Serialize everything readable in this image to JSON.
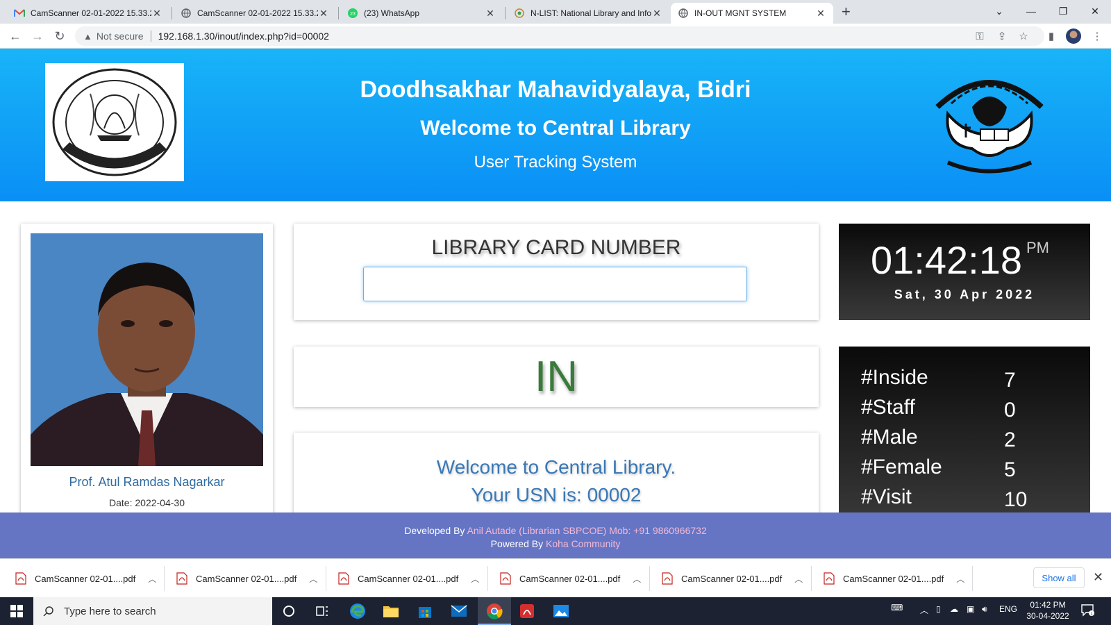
{
  "browser": {
    "tabs": [
      {
        "title": "CamScanner 02-01-2022 15.33.2",
        "icon": "gmail-icon",
        "active": false
      },
      {
        "title": "CamScanner 02-01-2022 15.33.2",
        "icon": "globe-icon",
        "active": false
      },
      {
        "title": "(23) WhatsApp",
        "icon": "whatsapp-icon",
        "active": false
      },
      {
        "title": "N-LIST: National Library and Info",
        "icon": "nlist-icon",
        "active": false
      },
      {
        "title": "IN-OUT MGNT SYSTEM",
        "icon": "globe-icon",
        "active": true
      }
    ],
    "security_label": "Not secure",
    "url": "192.168.1.30/inout/index.php?id=00002"
  },
  "header": {
    "title": "Doodhsakhar Mahavidyalaya, Bidri",
    "subtitle": "Welcome to Central Library",
    "tagline": "User Tracking System"
  },
  "user": {
    "name": "Prof. Atul Ramdas Nagarkar",
    "date": "Date: 2022-04-30"
  },
  "card_input": {
    "label": "LIBRARY CARD NUMBER",
    "value": ""
  },
  "status": "IN",
  "message": {
    "line1": "Welcome to Central Library.",
    "line2": "Your USN is: 00002"
  },
  "clock": {
    "time": "01:42:18",
    "ampm": "PM",
    "date": "Sat, 30 Apr 2022"
  },
  "stats": [
    {
      "label": "#Inside",
      "value": "7"
    },
    {
      "label": "#Staff",
      "value": "0"
    },
    {
      "label": "#Male",
      "value": "2"
    },
    {
      "label": "#Female",
      "value": "5"
    },
    {
      "label": "#Visit",
      "value": "10"
    }
  ],
  "footer": {
    "developed_by": "Developed By",
    "developer": "Anil Autade (Librarian SBPCOE) Mob: +91 9860966732",
    "powered_by": "Powered By",
    "platform": "Koha Community"
  },
  "downloads": {
    "items": [
      "CamScanner 02-01....pdf",
      "CamScanner 02-01....pdf",
      "CamScanner 02-01....pdf",
      "CamScanner 02-01....pdf",
      "CamScanner 02-01....pdf",
      "CamScanner 02-01....pdf"
    ],
    "show_all": "Show all"
  },
  "taskbar": {
    "search_placeholder": "Type here to search",
    "language": "ENG",
    "time": "01:42 PM",
    "date": "30-04-2022",
    "notification_count": "1"
  },
  "colors": {
    "header_blue": "#0a8ff5",
    "status_green": "#3a7a3a",
    "message_blue": "#3a78b5",
    "footer_purple": "#6575c4"
  }
}
